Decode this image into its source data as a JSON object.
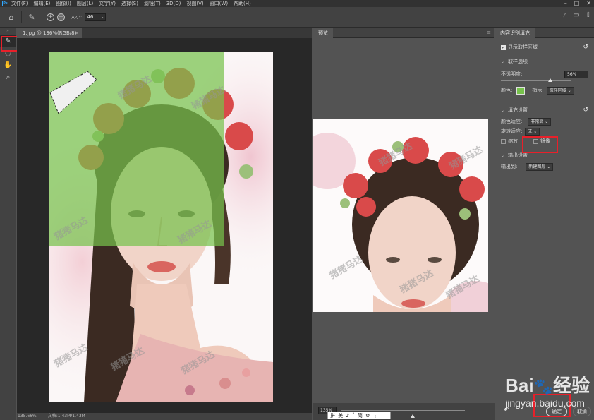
{
  "app": {
    "logo": "Ps"
  },
  "menu": [
    "文件(F)",
    "编辑(E)",
    "图像(I)",
    "图层(L)",
    "文字(Y)",
    "选择(S)",
    "滤镜(T)",
    "3D(D)",
    "视图(V)",
    "窗口(W)",
    "帮助(H)"
  ],
  "options": {
    "size_label": "大小:",
    "size_value": "46"
  },
  "document": {
    "tab_title": "1.jpg @ 136%(RGB/8)",
    "status_zoom": "135.66%",
    "status_info": "文档:1.43M/1.43M",
    "watermark": "猪猪马达"
  },
  "preview": {
    "tab": "预览",
    "zoom": "135%",
    "ime_text": "拼 美 ♪ ˚ 简 ⚙ ⋮"
  },
  "props": {
    "tab": "内容识别填充",
    "show_sampling": "显示取样区域",
    "sampling_options_title": "取样选项",
    "opacity_label": "不透明度:",
    "opacity_value": "56%",
    "color_label": "颜色:",
    "indicate_label": "指示:",
    "indicate_value": "取样区域",
    "fill_settings_title": "填充设置",
    "color_adapt_label": "颜色适应:",
    "color_adapt_value": "非常高",
    "rotation_adapt_label": "旋转适应:",
    "rotation_adapt_value": "无",
    "scale_label": "缩放",
    "mirror_label": "镜像",
    "output_settings_title": "输出设置",
    "output_to_label": "输出到:",
    "output_to_value": "新建图层",
    "ok": "确定",
    "cancel": "取消"
  },
  "baidu": {
    "brand": "Bai",
    "brand2": "经验",
    "url": "jingyan.baidu.com"
  },
  "colors": {
    "accent": "#31a8ff",
    "highlight": "#e8202a",
    "overlay": "#77c24c"
  }
}
